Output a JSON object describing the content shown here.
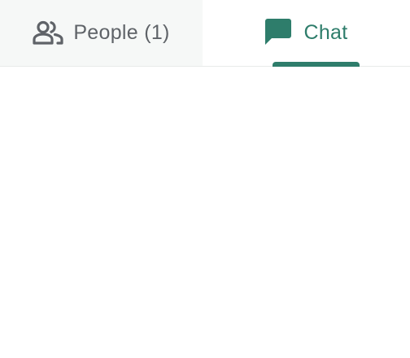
{
  "tabs": {
    "people": {
      "label": "People (1)",
      "icon": "people-icon",
      "color": "#5f6368",
      "background": "#f6f8f7"
    },
    "chat": {
      "label": "Chat",
      "icon": "chat-icon",
      "color": "#2e7d6b",
      "selected": true
    }
  },
  "colors": {
    "accent": "#2e7d6b",
    "divider": "#e8ebea"
  }
}
